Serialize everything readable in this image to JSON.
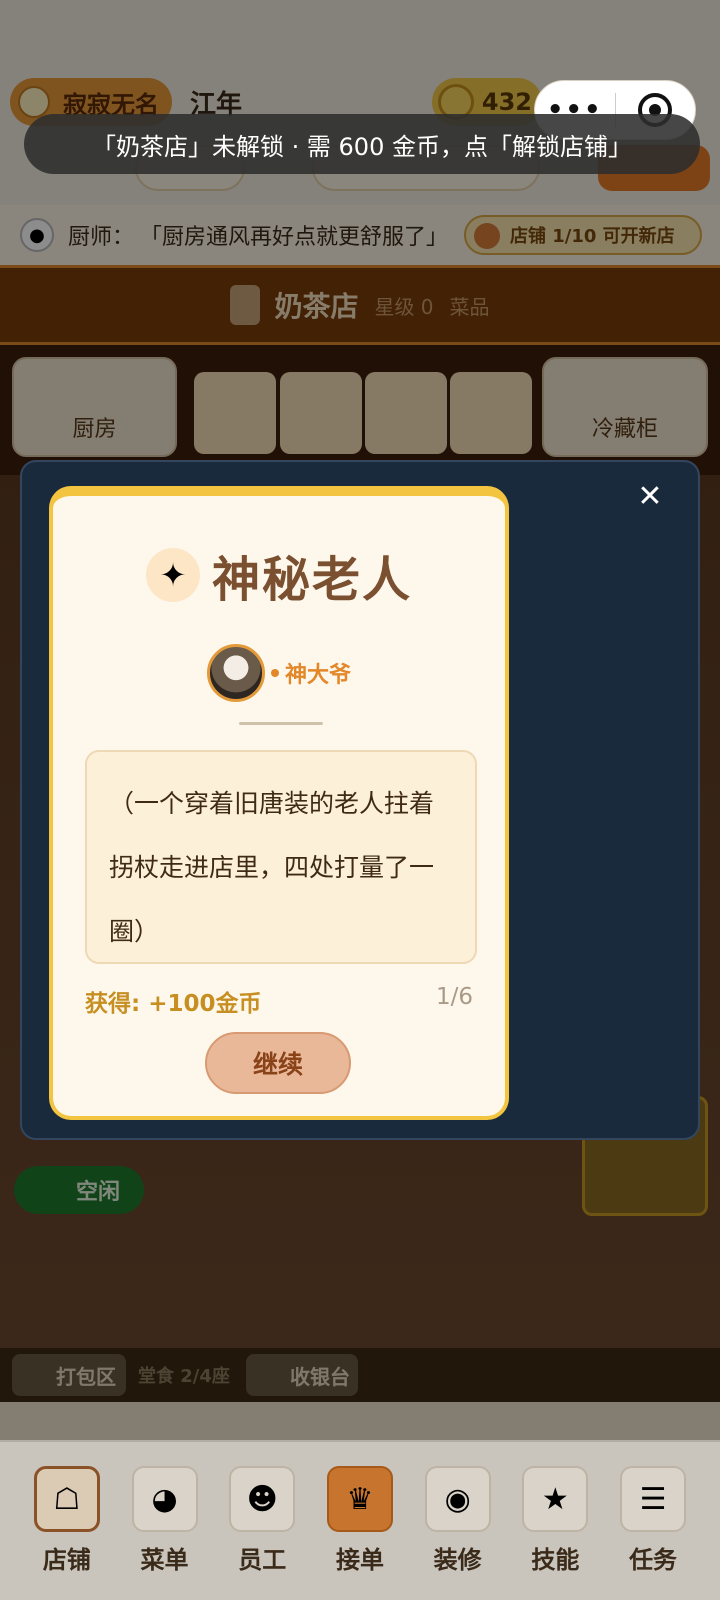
{
  "topbar": {
    "player_name": "寂寂无名",
    "location": "江年",
    "coins": "432"
  },
  "toast": {
    "message": "「奶茶店」未解锁 · 需 600 金币，点「解锁店铺」"
  },
  "chef_bar": {
    "speaker": "厨师：",
    "quote": "「厨房通风再好点就更舒服了」",
    "shop_status": "店铺 1/10 可开新店"
  },
  "shop_header": {
    "name": "奶茶店",
    "level": "星级 0",
    "menu": "菜品"
  },
  "stations": {
    "kitchen": "厨房",
    "fridge": "冷藏柜"
  },
  "status": {
    "idle": "空闲"
  },
  "pack_row": {
    "pack": "打包区",
    "seats": "堂食 2/4座",
    "cashier": "收银台"
  },
  "modal": {
    "title": "神秘老人",
    "speaker_name": "神大爷",
    "dialog": "（一个穿着旧唐装的老人拄着拐杖走进店里，四处打量了一圈）",
    "reward": "获得: +100金币",
    "page": "1/6",
    "continue_label": "继续",
    "close_label": "✕"
  },
  "bottom_nav": {
    "items": [
      {
        "label": "店铺",
        "icon": "shop-icon"
      },
      {
        "label": "菜单",
        "icon": "menu-icon"
      },
      {
        "label": "员工",
        "icon": "staff-icon"
      },
      {
        "label": "接单",
        "icon": "order-icon"
      },
      {
        "label": "装修",
        "icon": "decor-icon"
      },
      {
        "label": "技能",
        "icon": "skill-icon"
      },
      {
        "label": "任务",
        "icon": "task-icon"
      }
    ]
  }
}
